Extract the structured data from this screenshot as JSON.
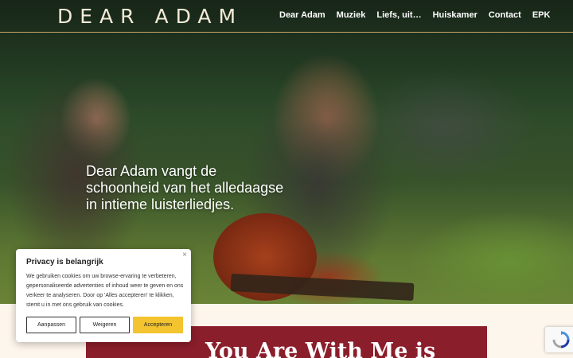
{
  "header": {
    "logo": "DEAR ADAM",
    "nav": [
      "Dear Adam",
      "Muziek",
      "Liefs, uit…",
      "Huiskamer",
      "Contact",
      "EPK"
    ]
  },
  "hero": {
    "tagline": "Dear Adam vangt de schoonheid van het alledaagse in intieme luisterliedjes."
  },
  "banner": {
    "title": "You Are With Me is"
  },
  "cookie": {
    "close": "×",
    "title": "Privacy is belangrijk",
    "body": "We gebruiken cookies om uw browse-ervaring te verbeteren, gepersonaliseerde advertenties of inhoud weer te geven en ons verkeer te analyseren. Door op 'Alles accepteren' te klikken, stemt u in met ons gebruik van cookies.",
    "customize": "Aanpassen",
    "reject": "Weigeren",
    "accept": "Accepteren"
  },
  "colors": {
    "accent": "#f4c430",
    "banner": "#8b1e2b",
    "header_rule": "#c9a86a",
    "page_bg": "#fdf6ec"
  },
  "icons": {
    "recaptcha": "recaptcha-icon"
  }
}
